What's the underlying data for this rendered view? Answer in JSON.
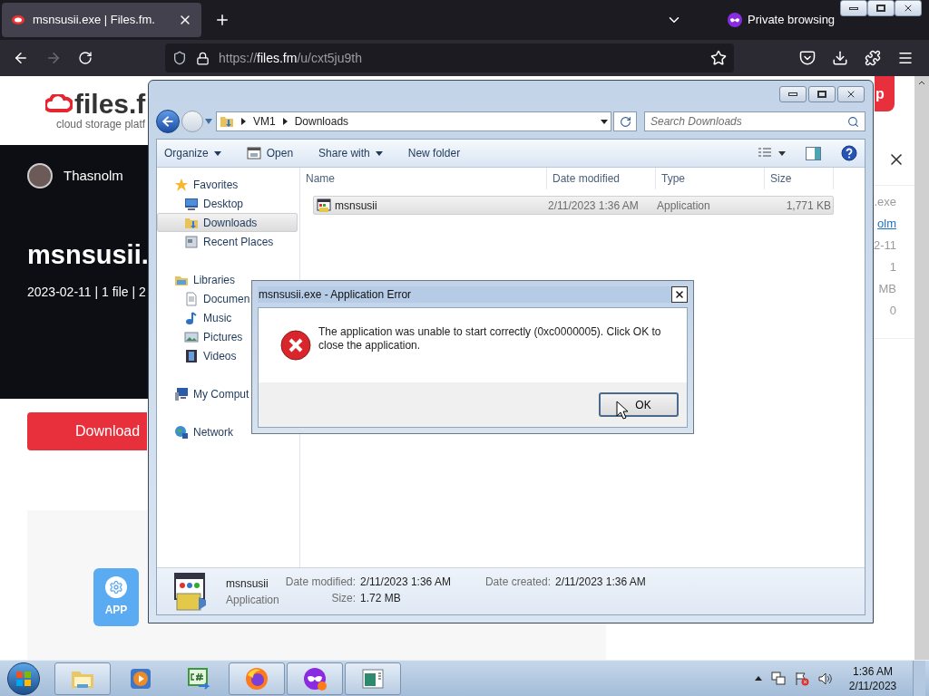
{
  "browser": {
    "tabs": [
      {
        "title": "msnsusii.exe | Files.fm.",
        "selected": true
      }
    ],
    "private_label": "Private browsing",
    "url": {
      "scheme": "https://",
      "host": "files.fm",
      "path": "/u/cxt5ju9th"
    },
    "forward_disabled": true
  },
  "page": {
    "logo": "files.f",
    "tagline": "cloud storage platf",
    "top_button": "p",
    "user": "Thasnolm",
    "title": "msnsusii.",
    "meta": "2023-02-11 | 1 file | 2",
    "download_button": "Download",
    "app_tile": "APP",
    "details": [
      {
        "text": ".exe",
        "kind": "text"
      },
      {
        "text": "olm",
        "kind": "link"
      },
      {
        "text": "2-11",
        "kind": "text"
      },
      {
        "text": "1",
        "kind": "text"
      },
      {
        "text": "MB",
        "kind": "text"
      },
      {
        "text": "0",
        "kind": "text"
      }
    ]
  },
  "explorer": {
    "breadcrumb": [
      "VM1",
      "Downloads"
    ],
    "search_placeholder": "Search Downloads",
    "toolbar": [
      {
        "label": "Organize",
        "kind": "menu"
      },
      {
        "label": "Open",
        "kind": "icon"
      },
      {
        "label": "Share with",
        "kind": "menu"
      },
      {
        "label": "New folder",
        "kind": "plain"
      }
    ],
    "nav": [
      {
        "label": "Favorites",
        "kind": "star",
        "selected": false,
        "children": [
          {
            "label": "Desktop",
            "kind": "desktop",
            "selected": false
          },
          {
            "label": "Downloads",
            "kind": "downloads",
            "selected": true
          },
          {
            "label": "Recent Places",
            "kind": "recent",
            "selected": false
          }
        ]
      },
      {
        "label": "Libraries",
        "kind": "library",
        "selected": false,
        "children": [
          {
            "label": "Documen",
            "kind": "document",
            "selected": false
          },
          {
            "label": "Music",
            "kind": "music",
            "selected": false
          },
          {
            "label": "Pictures",
            "kind": "pictures",
            "selected": false
          },
          {
            "label": "Videos",
            "kind": "videos",
            "selected": false
          }
        ]
      },
      {
        "label": "My Comput",
        "kind": "computer",
        "selected": false
      },
      {
        "label": "Network",
        "kind": "network",
        "selected": false
      }
    ],
    "columns": [
      "Name",
      "Date modified",
      "Type",
      "Size"
    ],
    "rows": [
      {
        "name": "msnsusii",
        "date": "2/11/2023 1:36 AM",
        "type": "Application",
        "size": "1,771 KB",
        "selected": true
      }
    ],
    "details": {
      "name": "msnsusii",
      "type": "Application",
      "fields": [
        {
          "label": "Date modified:",
          "value": "2/11/2023 1:36 AM"
        },
        {
          "label": "Size:",
          "value": "1.72 MB"
        },
        {
          "label": "Date created:",
          "value": "2/11/2023 1:36 AM"
        }
      ]
    }
  },
  "dialog": {
    "title": "msnsusii.exe - Application Error",
    "message": "The application was unable to start correctly (0xc0000005). Click OK to close the application.",
    "button": "OK"
  },
  "taskbar": {
    "buttons": [
      {
        "kind": "explorer",
        "open": true
      },
      {
        "kind": "media",
        "open": false
      },
      {
        "kind": "csharp",
        "open": false
      },
      {
        "kind": "firefox",
        "open": true
      },
      {
        "kind": "private",
        "open": true
      },
      {
        "kind": "window",
        "open": true
      }
    ],
    "clock": {
      "time": "1:36 AM",
      "date": "2/11/2023"
    }
  }
}
